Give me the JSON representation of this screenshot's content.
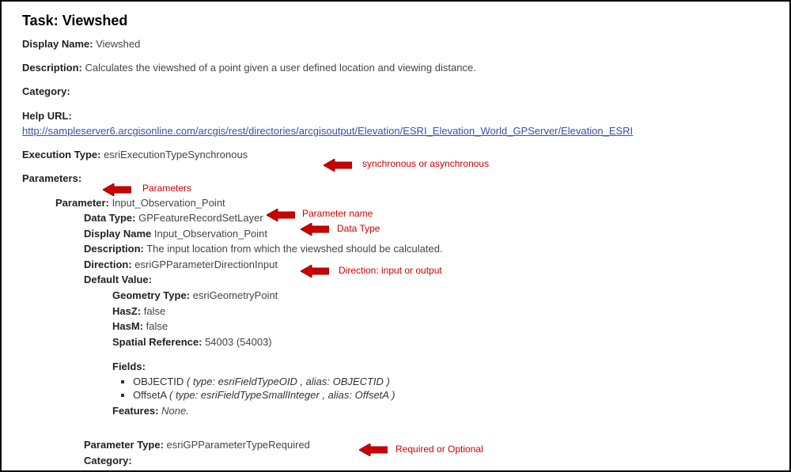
{
  "task": {
    "title_label": "Task:",
    "title_value": "Viewshed",
    "displayName_label": "Display Name:",
    "displayName_value": "Viewshed",
    "description_label": "Description:",
    "description_value": "Calculates the viewshed of a point given a user defined location and viewing distance.",
    "category_label": "Category:",
    "helpUrl_label": "Help URL:",
    "helpUrl_value": "http://sampleserver6.arcgisonline.com/arcgis/rest/directories/arcgisoutput/Elevation/ESRI_Elevation_World_GPServer/Elevation_ESRI",
    "execType_label": "Execution Type:",
    "execType_value": "esriExecutionTypeSynchronous",
    "parameters_label": "Parameters:"
  },
  "param": {
    "parameter_label": "Parameter:",
    "parameter_value": "Input_Observation_Point",
    "dataType_label": "Data Type:",
    "dataType_value": "GPFeatureRecordSetLayer",
    "displayName_label": "Display Name",
    "displayName_value": "Input_Observation_Point",
    "description_label": "Description:",
    "description_value": "The input location from which the viewshed should be calculated.",
    "direction_label": "Direction:",
    "direction_value": "esriGPParameterDirectionInput",
    "defaultValue_label": "Default Value:",
    "geometryType_label": "Geometry Type:",
    "geometryType_value": "esriGeometryPoint",
    "hasZ_label": "HasZ:",
    "hasZ_value": "false",
    "hasM_label": "HasM:",
    "hasM_value": "false",
    "spatialRef_label": "Spatial Reference:",
    "spatialRef_value": "54003  (54003)",
    "fields_label": "Fields:",
    "field1_name": "OBJECTID",
    "field1_detail": "( type: esriFieldTypeOID , alias: OBJECTID )",
    "field2_name": "OffsetA",
    "field2_detail": "( type: esriFieldTypeSmallInteger , alias: OffsetA )",
    "features_label": "Features:",
    "features_value": "None.",
    "paramType_label": "Parameter Type:",
    "paramType_value": "esriGPParameterTypeRequired",
    "category_label": "Category:"
  },
  "annotations": {
    "execType": "synchronous or asynchronous",
    "parameters": "Parameters",
    "paramName": "Parameter name",
    "dataType": "Data Type",
    "direction": "Direction: input or output",
    "paramType": "Required or Optional"
  }
}
